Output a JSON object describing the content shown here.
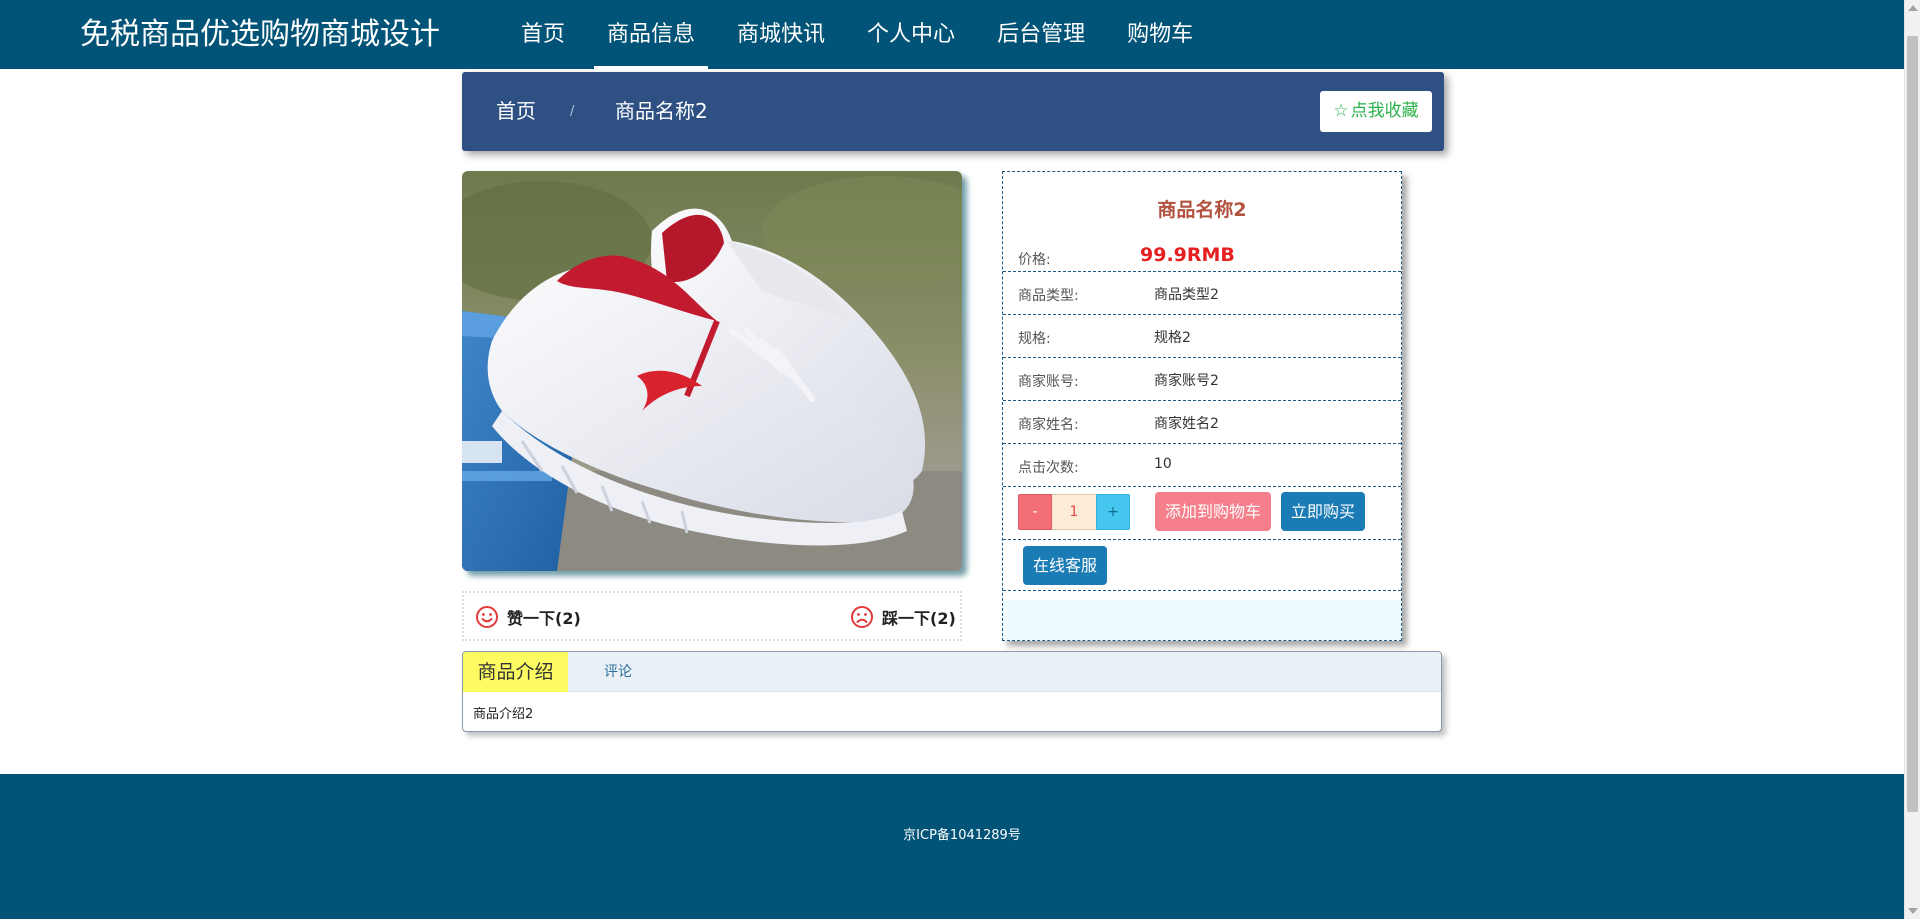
{
  "header": {
    "site_title": "免税商品优选购物商城设计",
    "nav": [
      {
        "label": "首页"
      },
      {
        "label": "商品信息",
        "active": true
      },
      {
        "label": "商城快讯"
      },
      {
        "label": "个人中心"
      },
      {
        "label": "后台管理"
      },
      {
        "label": "购物车"
      }
    ]
  },
  "breadcrumb": {
    "home": "首页",
    "separator": "/",
    "current": "商品名称2",
    "favorite_label": "点我收藏",
    "favorite_icon": "star-outline-icon"
  },
  "product": {
    "title": "商品名称2",
    "image_description": "white-sneaker-photo",
    "price_label": "价格:",
    "price_value": "99.9RMB",
    "fields": [
      {
        "label": "商品类型:",
        "value": "商品类型2"
      },
      {
        "label": "规格:",
        "value": "规格2"
      },
      {
        "label": "商家账号:",
        "value": "商家账号2"
      },
      {
        "label": "商家姓名:",
        "value": "商家姓名2"
      },
      {
        "label": "点击次数:",
        "value": "10"
      }
    ],
    "quantity": {
      "minus": "-",
      "value": "1",
      "plus": "+"
    },
    "add_to_cart": "添加到购物车",
    "buy_now": "立即购买",
    "online_service": "在线客服"
  },
  "votes": {
    "like": "赞一下(2)",
    "dislike": "踩一下(2)"
  },
  "tabs": {
    "items": [
      {
        "label": "商品介绍",
        "active": true
      },
      {
        "label": "评论"
      }
    ],
    "content": "商品介绍2"
  },
  "footer": {
    "icp": "京ICP备1041289号"
  },
  "colors": {
    "header_bg": "#015478",
    "breadcrumb_bg": "#2e5082",
    "price": "#e52020",
    "title": "#b1523f",
    "cart_button": "#f5808c",
    "buy_button": "#1a7bb5",
    "active_tab": "#fcfc62"
  }
}
